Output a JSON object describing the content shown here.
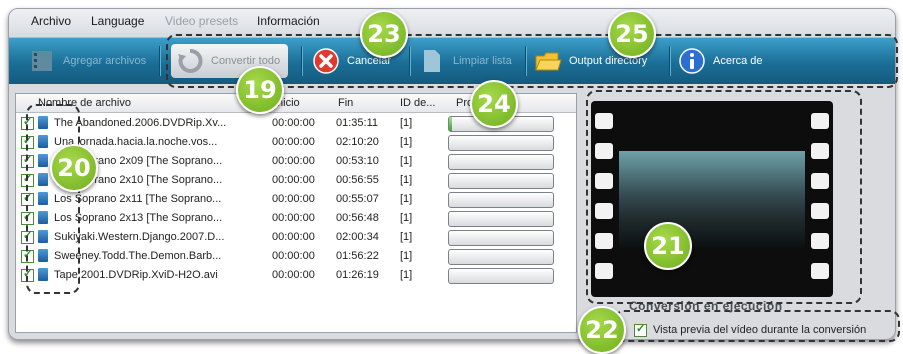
{
  "menu": {
    "items": [
      {
        "label": "Archivo",
        "disabled": false
      },
      {
        "label": "Language",
        "disabled": false
      },
      {
        "label": "Video presets",
        "disabled": true
      },
      {
        "label": "Información",
        "disabled": false
      }
    ]
  },
  "toolbar": {
    "add_files": "Agregar archivos",
    "convert": "Convertir todo",
    "cancel": "Cancelar",
    "clear_list": "Limpiar lista",
    "output_dir": "Output directory",
    "about": "Acerca de"
  },
  "file_list": {
    "columns": {
      "name": "Nombre de archivo",
      "start": "Inicio",
      "end": "Fin",
      "id": "ID de...",
      "progress": "Progreso"
    },
    "rows": [
      {
        "name": "The Abandoned.2006.DVDRip.Xv...",
        "start": "00:00:00",
        "end": "01:35:11",
        "id": "[1]",
        "progress": 0.03
      },
      {
        "name": "Una jornada.hacia.la.noche.vos...",
        "start": "00:00:00",
        "end": "02:10:20",
        "id": "[1]",
        "progress": 0
      },
      {
        "name": "Los Soprano 2x09 [The Soprano...",
        "start": "00:00:00",
        "end": "00:53:10",
        "id": "[1]",
        "progress": 0
      },
      {
        "name": "Los Soprano 2x10 [The Soprano...",
        "start": "00:00:00",
        "end": "00:56:55",
        "id": "[1]",
        "progress": 0
      },
      {
        "name": "Los Soprano 2x11 [The Soprano...",
        "start": "00:00:00",
        "end": "00:55:07",
        "id": "[1]",
        "progress": 0
      },
      {
        "name": "Los Soprano 2x13 [The Soprano...",
        "start": "00:00:00",
        "end": "00:56:48",
        "id": "[1]",
        "progress": 0
      },
      {
        "name": "Sukiyaki.Western.Django.2007.D...",
        "start": "00:00:00",
        "end": "02:00:34",
        "id": "[1]",
        "progress": 0
      },
      {
        "name": "Sweeney.Todd.The.Demon.Barb...",
        "start": "00:00:00",
        "end": "01:56:22",
        "id": "[1]",
        "progress": 0
      },
      {
        "name": "Tape.2001.DVDRip.XviD-H2O.avi",
        "start": "00:00:00",
        "end": "01:26:19",
        "id": "[1]",
        "progress": 0
      }
    ]
  },
  "preview": {
    "status_text": "Conversión en ejecución",
    "option_label": "Vista previa del vídeo durante la conversión"
  },
  "callouts": [
    "19",
    "20",
    "21",
    "22",
    "23",
    "24",
    "25"
  ],
  "colors": {
    "toolbar": "#1a6e97",
    "callout": "#8cc63f",
    "progress": "#3aa52b"
  }
}
